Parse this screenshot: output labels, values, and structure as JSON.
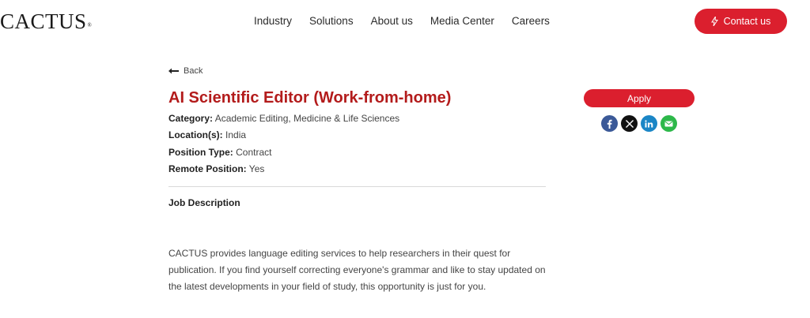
{
  "brand": {
    "logo_text": "CACTUS",
    "registered": "®"
  },
  "nav": {
    "items": [
      {
        "label": "Industry"
      },
      {
        "label": "Solutions"
      },
      {
        "label": "About us"
      },
      {
        "label": "Media Center"
      },
      {
        "label": "Careers"
      }
    ],
    "contact_label": "Contact us"
  },
  "job": {
    "back_label": "Back",
    "title": "AI Scientific Editor (Work-from-home)",
    "fields": [
      {
        "label": "Category:",
        "value": "Academic Editing, Medicine & Life Sciences"
      },
      {
        "label": "Location(s):",
        "value": "India"
      },
      {
        "label": "Position Type:",
        "value": "Contract"
      },
      {
        "label": "Remote Position:",
        "value": "Yes"
      }
    ],
    "section_title": "Job Description",
    "description": "CACTUS provides language editing services to help researchers in their quest for publication. If you find yourself correcting everyone's grammar and like to stay updated on the latest developments in your field of study, this opportunity is just for you."
  },
  "sidebar": {
    "apply_label": "Apply",
    "share_icons": [
      "facebook-icon",
      "x-icon",
      "linkedin-icon",
      "email-icon"
    ]
  },
  "colors": {
    "accent": "#db1f2e",
    "title": "#b31b1b",
    "facebook": "#3b5998",
    "x": "#111111",
    "linkedin": "#1b86c6",
    "email": "#2db84a"
  }
}
